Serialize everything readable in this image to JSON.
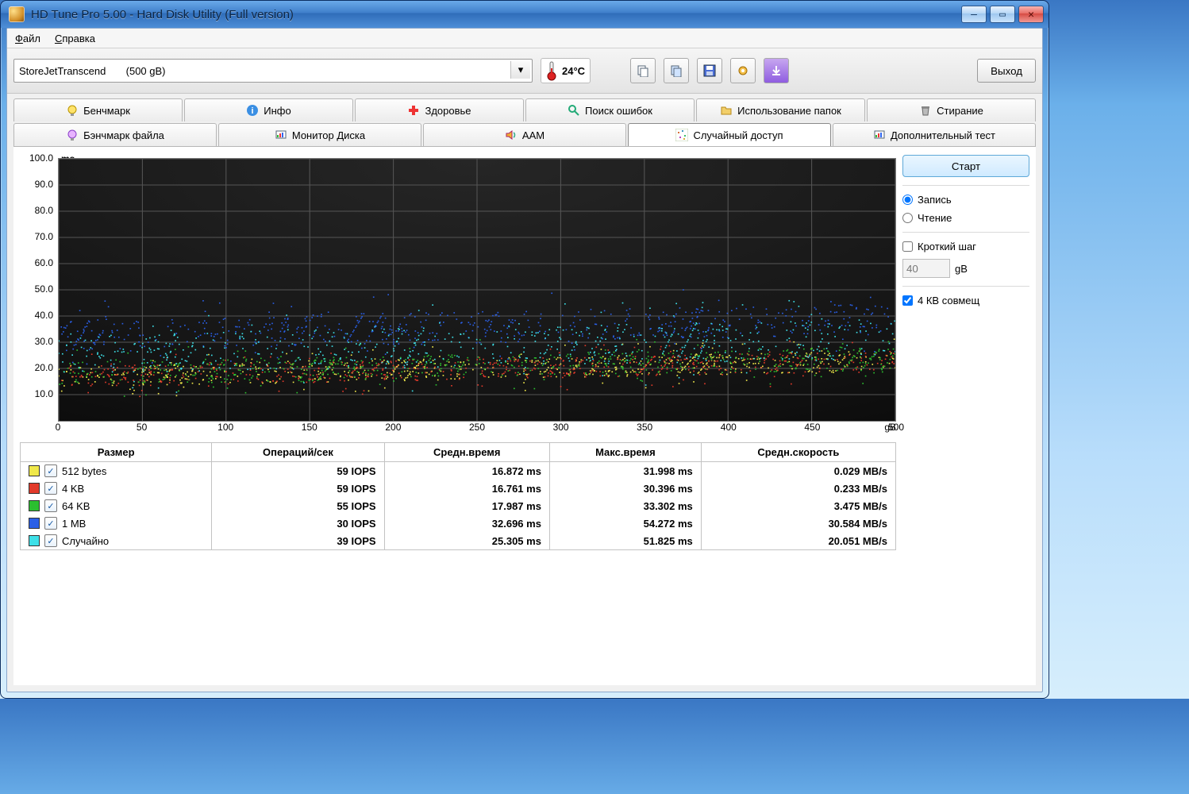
{
  "window": {
    "title": "HD Tune Pro 5.00 - Hard Disk Utility (Full  version)"
  },
  "menu": {
    "file": "Файл",
    "help": "Справка"
  },
  "toolbar": {
    "drive_text": "StoreJetTranscend       (500 gB)",
    "temperature": "24°C",
    "exit": "Выход"
  },
  "tabs_row1": [
    {
      "label": "Бенчмарк",
      "icon": "bulb"
    },
    {
      "label": "Инфо",
      "icon": "info"
    },
    {
      "label": "Здоровье",
      "icon": "health"
    },
    {
      "label": "Поиск ошибок",
      "icon": "search"
    },
    {
      "label": "Использование папок",
      "icon": "folder"
    },
    {
      "label": "Стирание",
      "icon": "trash"
    }
  ],
  "tabs_row2": [
    {
      "label": "Бэнчмарк файла",
      "icon": "bulb2"
    },
    {
      "label": "Монитор Диска",
      "icon": "monitor"
    },
    {
      "label": "ААМ",
      "icon": "sound"
    },
    {
      "label": "Случайный доступ",
      "icon": "dots",
      "active": true
    },
    {
      "label": "Дополнительный  тест",
      "icon": "monitor"
    }
  ],
  "side": {
    "start": "Старт",
    "radio_write": "Запись",
    "radio_read": "Чтение",
    "short_step": "Кроткий шаг",
    "step_value": "40",
    "step_unit": "gB",
    "align4k": "4 КВ совмещ"
  },
  "chart_data": {
    "type": "scatter",
    "title": "",
    "xlabel": "",
    "ylabel": "ms",
    "xunit": "gB",
    "xlim": [
      0,
      500
    ],
    "ylim": [
      0,
      100
    ],
    "xticks": [
      0,
      50,
      100,
      150,
      200,
      250,
      300,
      350,
      400,
      450,
      500
    ],
    "yticks": [
      10,
      20,
      30,
      40,
      50,
      60,
      70,
      80,
      90,
      100
    ],
    "series": [
      {
        "name": "512 bytes",
        "color": "#f0e84a",
        "mean_ms": 16.872,
        "spread_ms": 8
      },
      {
        "name": "4 KB",
        "color": "#e23a2a",
        "mean_ms": 16.761,
        "spread_ms": 8
      },
      {
        "name": "64 KB",
        "color": "#2bbf2f",
        "mean_ms": 17.987,
        "spread_ms": 9
      },
      {
        "name": "1 MB",
        "color": "#2a5fe6",
        "mean_ms": 32.696,
        "spread_ms": 12
      },
      {
        "name": "Случайно",
        "color": "#3de0e8",
        "mean_ms": 25.305,
        "spread_ms": 15
      }
    ],
    "n_points_per_series": 600
  },
  "results": {
    "columns": [
      "Размер",
      "Операций/сек",
      "Средн.время",
      "Макс.время",
      "Средн.скорость"
    ],
    "rows": [
      {
        "color": "#f0e84a",
        "size": "512 bytes",
        "iops": "59 IOPS",
        "avg": "16.872 ms",
        "max": "31.998 ms",
        "speed": "0.029 MB/s"
      },
      {
        "color": "#e23a2a",
        "size": "4 KB",
        "iops": "59 IOPS",
        "avg": "16.761 ms",
        "max": "30.396 ms",
        "speed": "0.233 MB/s"
      },
      {
        "color": "#2bbf2f",
        "size": "64 KB",
        "iops": "55 IOPS",
        "avg": "17.987 ms",
        "max": "33.302 ms",
        "speed": "3.475 MB/s"
      },
      {
        "color": "#2a5fe6",
        "size": "1 MB",
        "iops": "30 IOPS",
        "avg": "32.696 ms",
        "max": "54.272 ms",
        "speed": "30.584 MB/s"
      },
      {
        "color": "#3de0e8",
        "size": "Случайно",
        "iops": "39 IOPS",
        "avg": "25.305 ms",
        "max": "51.825 ms",
        "speed": "20.051 MB/s"
      }
    ]
  }
}
